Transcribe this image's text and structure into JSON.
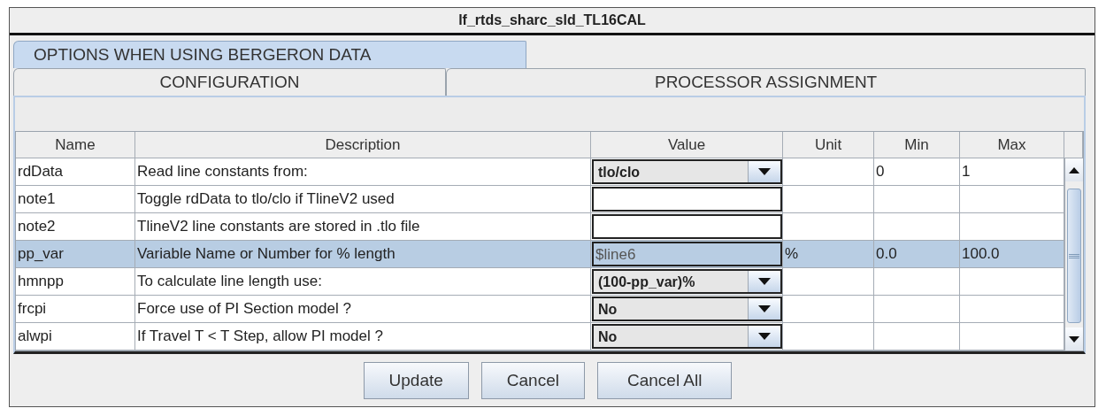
{
  "window": {
    "title": "lf_rtds_sharc_sld_TL16CAL"
  },
  "tab_rows": [
    [
      {
        "label": "OPTIONS WHEN USING BERGERON DATA",
        "selected": true
      }
    ],
    [
      {
        "label": "CONFIGURATION",
        "selected": false
      },
      {
        "label": "PROCESSOR ASSIGNMENT",
        "selected": false
      }
    ]
  ],
  "table": {
    "columns": [
      "Name",
      "Description",
      "Value",
      "Unit",
      "Min",
      "Max"
    ],
    "rows": [
      {
        "name": "rdData",
        "description": "Read line constants from:",
        "value": {
          "kind": "dropdown",
          "text": "tlo/clo"
        },
        "min": "0",
        "max": "1",
        "selected": false
      },
      {
        "name": "note1",
        "description": "Toggle rdData to tlo/clo if TlineV2 used",
        "value": {
          "kind": "field"
        },
        "selected": false
      },
      {
        "name": "note2",
        "description": "TlineV2 line constants are stored in .tlo file",
        "value": {
          "kind": "field"
        },
        "selected": false
      },
      {
        "name": "pp_var",
        "description": "Variable Name or Number for % length",
        "value": {
          "kind": "field",
          "text": "$line6"
        },
        "unit": "%",
        "min": "0.0",
        "max": "100.0",
        "selected": true
      },
      {
        "name": "hmnpp",
        "description": "To calculate line length use:",
        "value": {
          "kind": "dropdown",
          "text": "(100-pp_var)%"
        },
        "selected": false
      },
      {
        "name": "frcpi",
        "description": "Force use of PI Section model ?",
        "value": {
          "kind": "dropdown",
          "text": "No"
        },
        "selected": false
      },
      {
        "name": "alwpi",
        "description": "If Travel T < T Step, allow PI model ?",
        "value": {
          "kind": "dropdown",
          "text": "No"
        },
        "selected": false
      }
    ]
  },
  "buttons": [
    "Update",
    "Cancel",
    "Cancel All"
  ]
}
